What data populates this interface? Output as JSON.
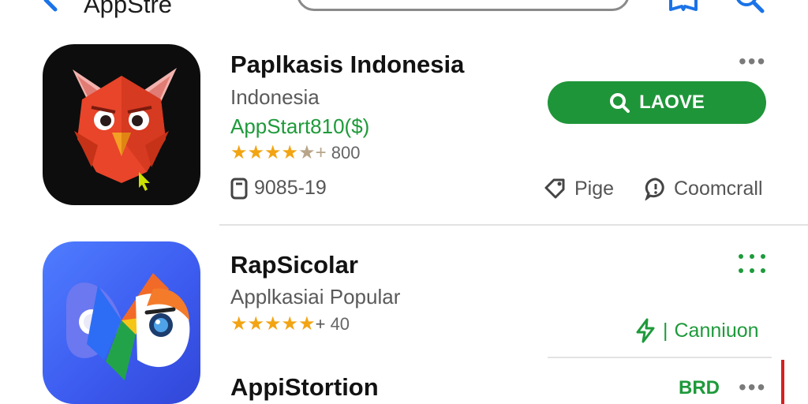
{
  "header": {
    "title": "AppStre",
    "back_icon": "chevron-left-icon",
    "search_placeholder": "",
    "book_icon": "book-icon",
    "search_icon": "search-icon"
  },
  "apps": [
    {
      "name": "Paplkasis Indonesia",
      "subtitle": "Indonesia",
      "publisher": "AppStart810($)",
      "stars": "★★★★",
      "stars_tail": "★+",
      "rating_count": "800",
      "rating_value": 4.5,
      "button_label": "LAOVE",
      "size": "9085-19",
      "actions": [
        {
          "label": "Pige",
          "icon": "tag-icon"
        },
        {
          "label": "Coomcrall",
          "icon": "comment-icon"
        }
      ]
    },
    {
      "name": "RapSicolar",
      "subtitle": "Applkasiai Popular",
      "stars": "★★★★★",
      "stars_tail": "+",
      "rating_count": "40",
      "rating_value": 4.5,
      "action_label": "Canniuon",
      "action_icon": "bolt-icon"
    },
    {
      "name": "AppiStortion",
      "tag": "BRD"
    }
  ],
  "colors": {
    "accent_green": "#1f9539",
    "star": "#f2a413",
    "red": "#d62020"
  }
}
